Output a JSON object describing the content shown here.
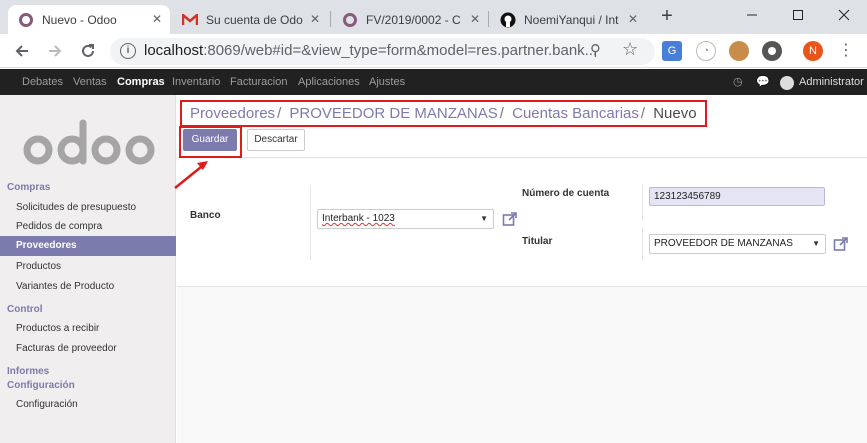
{
  "browser": {
    "tabs": [
      {
        "title": "Nuevo - Odoo",
        "icon": "odoo-icon",
        "active": true
      },
      {
        "title": "Su cuenta de Odo",
        "icon": "gmail-icon",
        "active": false
      },
      {
        "title": "FV/2019/0002 - C",
        "icon": "odoo-icon",
        "active": false
      },
      {
        "title": "NoemiYanqui / Int",
        "icon": "github-icon",
        "active": false
      }
    ],
    "url_host": "localhost",
    "url_rest": ":8069/web#id=&view_type=form&model=res.partner.bank...",
    "profile_initial": "N"
  },
  "odoo_nav": {
    "items": [
      "Debates",
      "Ventas",
      "Compras",
      "Inventario",
      "Facturacion",
      "Aplicaciones",
      "Ajustes"
    ],
    "active": "Compras",
    "user": "Administrator"
  },
  "sidebar": {
    "sections": [
      {
        "title": "Compras",
        "items": [
          "Solicitudes de presupuesto",
          "Pedidos de compra",
          "Proveedores",
          "Productos",
          "Variantes de Producto"
        ]
      },
      {
        "title": "Control",
        "items": [
          "Productos a recibir",
          "Facturas de proveedor"
        ]
      },
      {
        "title": "Informes",
        "items": []
      },
      {
        "title": "Configuración",
        "items": [
          "Configuración"
        ]
      }
    ],
    "active_item": "Proveedores"
  },
  "breadcrumb": [
    "Proveedores",
    "PROVEEDOR DE MANZANAS",
    "Cuentas Bancarias",
    "Nuevo"
  ],
  "buttons": {
    "save": "Guardar",
    "discard": "Descartar"
  },
  "form": {
    "banco_label": "Banco",
    "banco_value": "Interbank - 1023",
    "cuenta_label": "Número de cuenta",
    "cuenta_value": "123123456789",
    "titular_label": "Titular",
    "titular_value": "PROVEEDOR DE MANZANAS"
  },
  "colors": {
    "odoo_purple": "#7c7bad",
    "highlight_red": "#e01b1b"
  }
}
